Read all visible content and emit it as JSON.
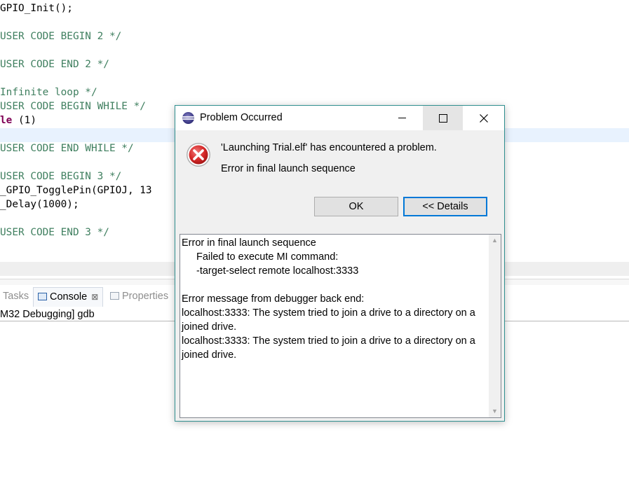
{
  "editor": {
    "lines": [
      "GPIO_Init();",
      "USER CODE BEGIN 2 */",
      "USER CODE END 2 */",
      "Infinite loop */",
      "USER CODE BEGIN WHILE */",
      "le",
      " (1)",
      "USER CODE END WHILE */",
      "USER CODE BEGIN 3 */",
      "_GPIO_TogglePin(GPIOJ, 13",
      "_Delay(1000);",
      "USER CODE END 3 */"
    ]
  },
  "bottom_view": {
    "tabs": [
      {
        "label": "Tasks"
      },
      {
        "label": "Console",
        "close": "⊠"
      },
      {
        "label": "Properties"
      }
    ],
    "console_text": "M32 Debugging] gdb"
  },
  "dialog": {
    "title": "Problem Occurred",
    "icon": "error-icon",
    "message": "'Launching Trial.elf' has encountered a problem.",
    "detail_summary": "Error in final launch sequence",
    "ok_label": "OK",
    "details_label": "<< Details",
    "details": {
      "line1": "Error in final launch sequence",
      "line2": "Failed to execute MI command:",
      "line3": "-target-select remote localhost:3333",
      "line4": "Error message from debugger back end:",
      "line5": "localhost:3333: The system tried to join a drive to a directory on a joined drive.",
      "line6": "localhost:3333: The system tried to join a drive to a directory on a joined drive."
    },
    "colors": {
      "accent": "#0078d7",
      "error": "#d62828",
      "border": "#2f8f8f"
    }
  }
}
